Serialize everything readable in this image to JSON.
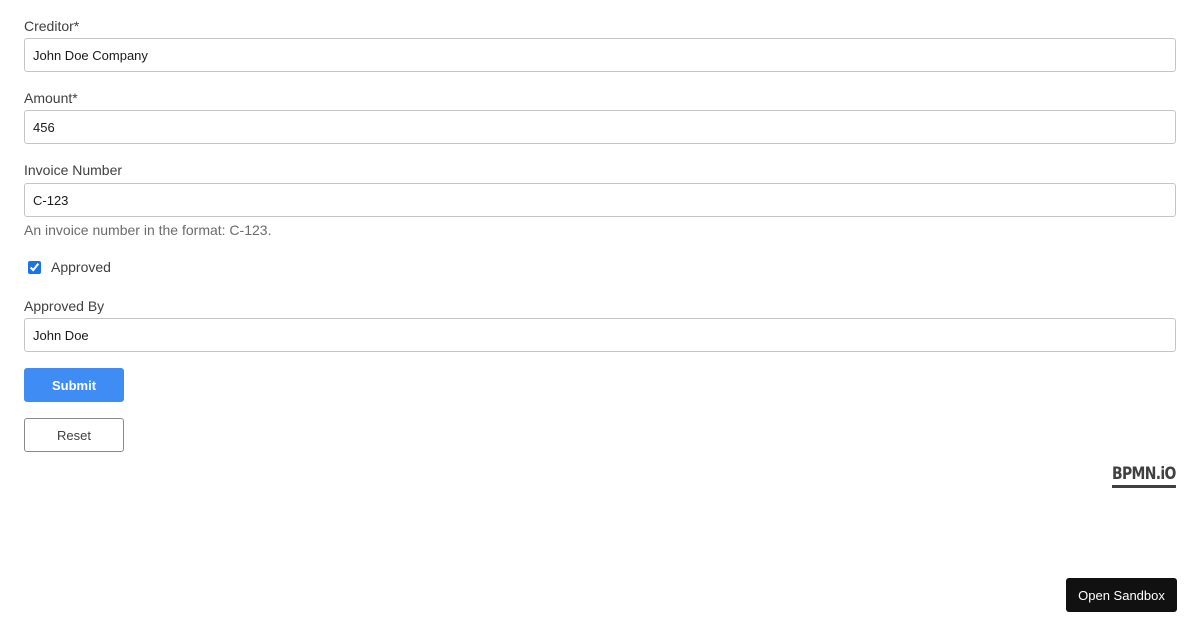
{
  "form": {
    "creditor": {
      "label": "Creditor*",
      "value": "John Doe Company"
    },
    "amount": {
      "label": "Amount*",
      "value": "456"
    },
    "invoice_number": {
      "label": "Invoice Number",
      "value": "C-123",
      "description": "An invoice number in the format: C-123."
    },
    "approved": {
      "label": "Approved",
      "checked": true
    },
    "approved_by": {
      "label": "Approved By",
      "value": "John Doe"
    },
    "submit_label": "Submit",
    "reset_label": "Reset"
  },
  "branding": {
    "logo_text": "BPMN.iO"
  },
  "sandbox_button": {
    "label": "Open Sandbox"
  },
  "colors": {
    "submit_button": "#3f8cf5",
    "checkbox_accent": "#1a73e8",
    "sandbox_button": "#111111"
  },
  "icons": {
    "checkbox": "checkbox-checked-icon"
  }
}
